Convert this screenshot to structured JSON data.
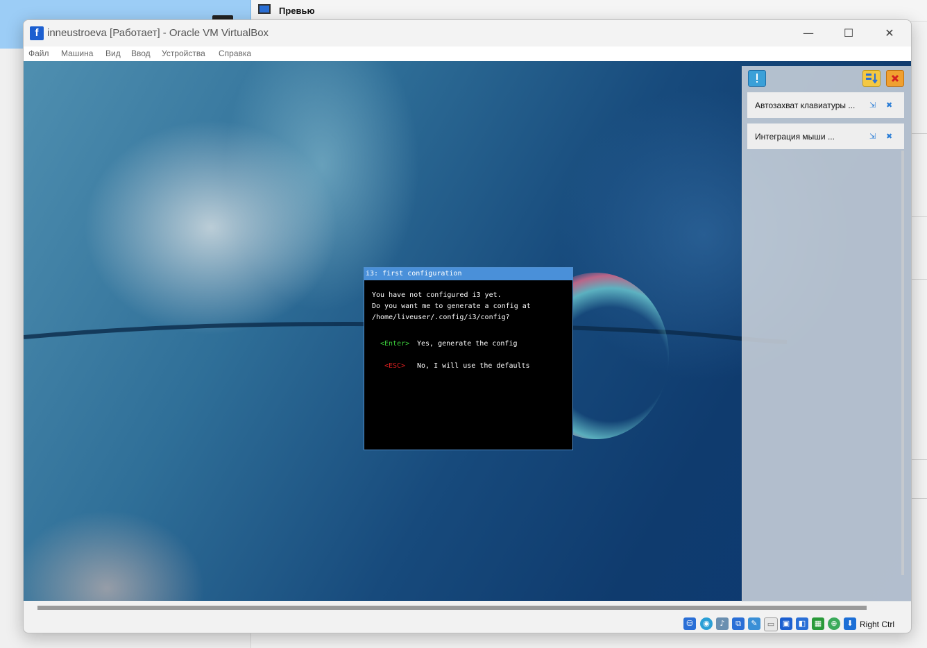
{
  "background": {
    "preview_label": "Превью"
  },
  "window": {
    "title": "inneustroeva [Работает] - Oracle VM VirtualBox",
    "icon_glyph": "f",
    "minimize": "—",
    "maximize": "☐",
    "close": "✕"
  },
  "menu": {
    "items": [
      "Файл",
      "Машина",
      "Вид",
      "Ввод",
      "Устройства",
      "Справка"
    ]
  },
  "i3_dialog": {
    "title": "i3: first configuration",
    "message": "You have not configured i3 yet.\nDo you want me to generate a config at\n/home/liveuser/.config/i3/config?",
    "enter_key": "<Enter>",
    "enter_text": "Yes, generate the config",
    "esc_key": "<ESC>",
    "esc_text": "No, I will use the defaults"
  },
  "notifications": {
    "items": [
      {
        "label": "Автозахват клавиатуры ..."
      },
      {
        "label": "Интеграция мыши ..."
      }
    ]
  },
  "status_bar": {
    "host_key": "Right Ctrl",
    "icons": [
      "hard-disk-icon",
      "optical-drive-icon",
      "audio-icon",
      "network-icon",
      "usb-icon",
      "shared-folders-icon",
      "display-icon",
      "video-capture-icon",
      "cpu-icon",
      "mouse-integration-icon",
      "keyboard-icon"
    ]
  },
  "colors": {
    "i3_title_bar": "#4a90d9",
    "enter_key": "#3cd13c",
    "esc_key": "#e02020",
    "accent": "#1c5fd0"
  }
}
